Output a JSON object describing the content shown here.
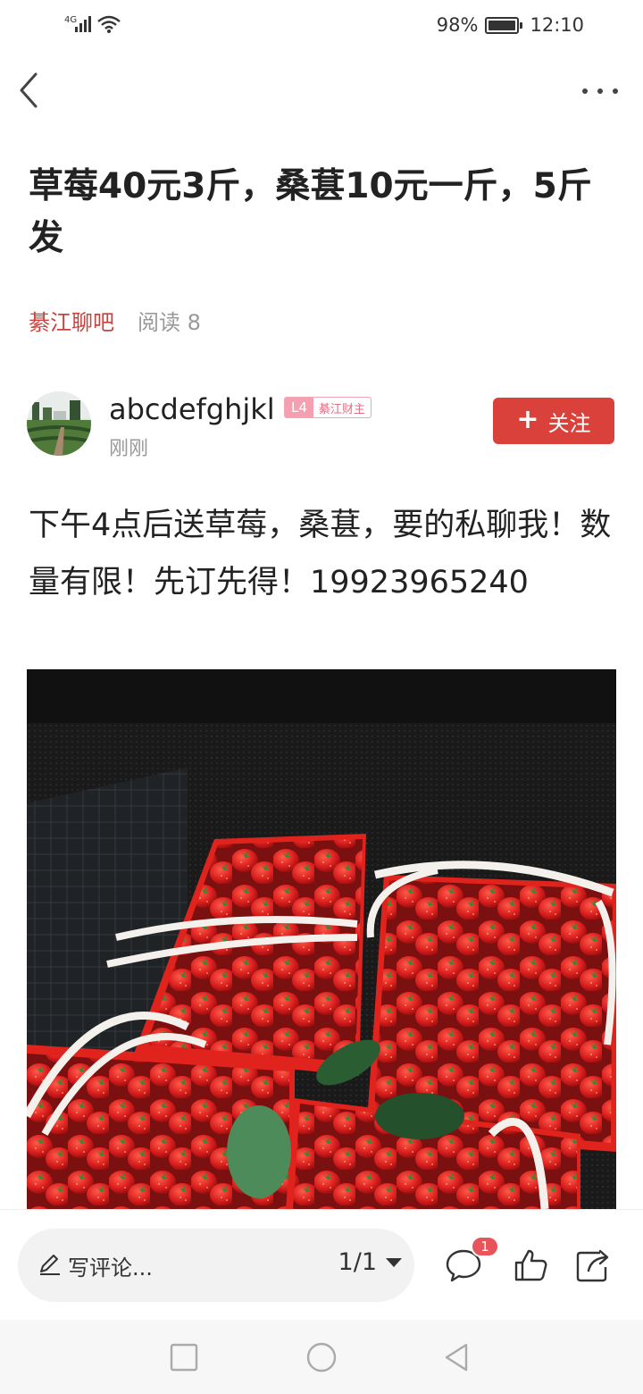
{
  "status_bar": {
    "network": "4G",
    "battery_text": "98%",
    "battery_level": 0.98,
    "time": "12:10"
  },
  "nav": {
    "back_icon": "chevron-left-icon",
    "more_icon": "ellipsis-icon"
  },
  "post": {
    "title": "草莓40元3斤，桑葚10元一斤，5斤发",
    "forum": "綦江聊吧",
    "read_count": "阅读 8",
    "author": {
      "name": "abcdefghjkl",
      "level": "L4",
      "badge": "綦江财主",
      "time": "刚刚",
      "follow_label": "关注"
    },
    "body": "下午4点后送草莓，桑葚，要的私聊我！数量有限！先订先得！19923965240"
  },
  "bottom_bar": {
    "comment_placeholder": "写评论...",
    "page_indicator": "1/1",
    "comment_count": "1"
  },
  "colors": {
    "accent": "#d9413a",
    "forum": "#c9423d",
    "badge": "#f4a0b1",
    "muted": "#999999"
  }
}
